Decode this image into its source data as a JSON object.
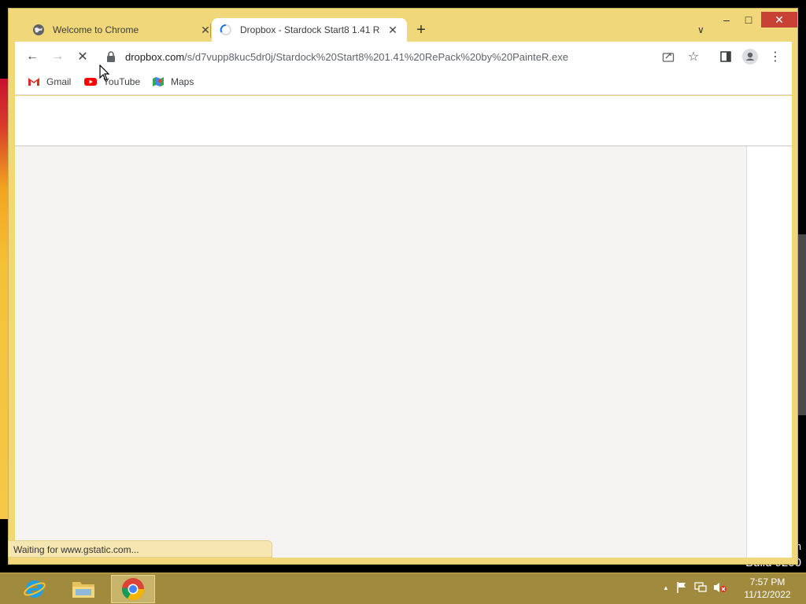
{
  "desktop": {
    "build_partial": "Build 9200",
    "edition_partial": "n"
  },
  "window": {
    "minimize": "–",
    "maximize": "□",
    "close": "✕"
  },
  "tabs": [
    {
      "title": "Welcome to Chrome",
      "favicon": "chrome-globe-icon",
      "active": false
    },
    {
      "title": "Dropbox - Stardock Start8 1.41 R",
      "favicon": "loading-spinner-icon",
      "active": true
    }
  ],
  "tabstrip": {
    "new_tab": "+",
    "tab_list": "∨"
  },
  "toolbar": {
    "back": "←",
    "forward": "→",
    "stop": "✕",
    "url_host": "dropbox.com",
    "url_path": "/s/d7vupp8kuc5dr0j/Stardock%20Start8%201.41%20RePack%20by%20PainteR.exe",
    "star": "☆",
    "menu": "⋮"
  },
  "bookmarks": [
    {
      "label": "Gmail",
      "icon": "gmail-icon"
    },
    {
      "label": "YouTube",
      "icon": "youtube-icon"
    },
    {
      "label": "Maps",
      "icon": "maps-icon"
    }
  ],
  "status_bar": {
    "text": "Waiting for www.gstatic.com..."
  },
  "taskbar": {
    "apps": [
      {
        "name": "Internet Explorer",
        "icon": "ie-icon"
      },
      {
        "name": "File Explorer",
        "icon": "folder-icon"
      },
      {
        "name": "Google Chrome",
        "icon": "chrome-icon",
        "active": true
      }
    ],
    "clock_time": "7:57 PM",
    "clock_date": "11/12/2022",
    "tray_expand": "▲"
  },
  "colors": {
    "window_frame": "#efd77a",
    "taskbar": "#a08a3e",
    "close_button": "#c74134",
    "page_body": "#f5f4f2"
  }
}
